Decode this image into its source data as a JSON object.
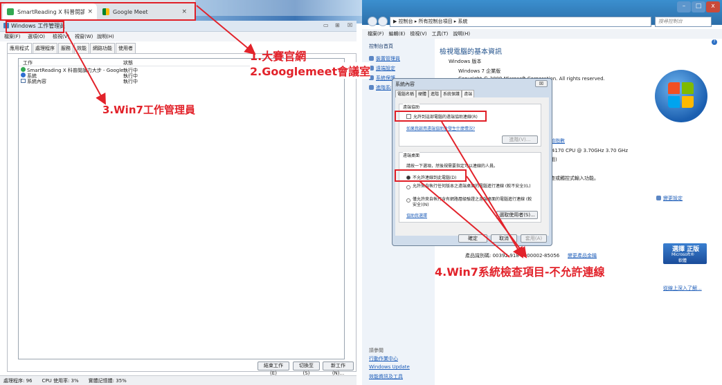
{
  "browser": {
    "tabs": [
      {
        "label": "SmartReading X 科普閱讀力大步",
        "close": "×"
      },
      {
        "label": "Google Meet",
        "close": "×"
      }
    ]
  },
  "task_manager": {
    "title": "Windows 工作管理員",
    "window_controls": [
      "▭",
      "⊞",
      "☒"
    ],
    "menu": [
      "檔案(F)",
      "選項(O)",
      "檢視(V)",
      "視窗(W)",
      "說明(H)"
    ],
    "tabs": [
      "應用程式",
      "處理程序",
      "服務",
      "效能",
      "網路功能",
      "使用者"
    ],
    "columns": {
      "task": "工作",
      "status": "狀態"
    },
    "rows": [
      {
        "task": "SmartReading X 科普閱讀力大步 - Google Chro...",
        "status": "執行中",
        "color": "#33a852"
      },
      {
        "task": "系統",
        "status": "執行中",
        "color": "#2f6fd1"
      },
      {
        "task": "系統內容",
        "status": "執行中",
        "color": "#4a6fa0"
      }
    ],
    "buttons": {
      "end": "結束工作(E)",
      "switch": "切換至(S)",
      "new": "新工作(N)..."
    },
    "status_bar": [
      "處理程序: 96",
      "CPU 使用率: 3%",
      "實體記憶體: 35%"
    ]
  },
  "control_panel": {
    "caption": [
      "–",
      "□",
      "x"
    ],
    "breadcrumb": "▶ 控制台 ▸ 所有控制台項目 ▸ 系統",
    "search_placeholder": "搜尋控制台",
    "menu": [
      "檔案(F)",
      "編輯(E)",
      "檢視(V)",
      "工具(T)",
      "說明(H)"
    ],
    "sidebar": {
      "home": "控制台首頁",
      "links": [
        "裝置管理員",
        "遠端設定",
        "系統保護",
        "進階系統設定"
      ],
      "see_also": "請參閱",
      "bottom_links": [
        "行動作業中心",
        "Windows Update",
        "效能資訊及工具"
      ]
    },
    "main": {
      "heading": "檢視電腦的基本資訊",
      "edition_label": "Windows 版本",
      "edition": "Windows 7 企業版",
      "copyright": "Copyright © 2009 Microsoft Corporation. All rights reserved.",
      "rating": "體驗指數",
      "cpu": "i3-4170 CPU @ 3.70GHz   3.70 GHz",
      "ram": "可用)",
      "pen": "筆查或觸控式輸入功能。",
      "change_settings": "變更設定",
      "product_id": "產品識別碼: 00392-918-5000002-85056",
      "change_key": "變更產品金鑰",
      "genuine_line1": "選擇 正版",
      "genuine_brand": "Microsoft®",
      "genuine_line2": "軟體",
      "learn_more": "從線上深入了解..."
    }
  },
  "dialog": {
    "title": "系統內容",
    "close": "☒",
    "tabs": [
      "電腦名稱",
      "硬體",
      "進階",
      "系統保護",
      "遠端"
    ],
    "assist_group": "遠端協助",
    "assist_checkbox": "允許到這部電腦的遠端協助連線(R)",
    "assist_link": "如果我啟用遠端協助會發生什麼情況?",
    "advanced_btn": "進階(V)...",
    "desktop_group": "遠端桌面",
    "desktop_hint": "請按一下選項，然後視需要指定可以連線的人員。",
    "radio_none": "不允許連線到此電腦(D)",
    "radio_any": "允許來自執行任何版本之遠端桌面的電腦進行連線 (較不安全)(L)",
    "radio_nla": "僅允許來自執行含有網路層級驗證之遠端桌面的電腦進行連線 (較安全)(N)",
    "help_link": "協助我選擇",
    "select_users": "選取使用者(S)...",
    "ok": "確定",
    "cancel": "取消",
    "apply": "套用(A)"
  },
  "annotations": {
    "a1": "1.大賽官網",
    "a2": "2.Googlemeet會議室",
    "a3": "3.Win7工作管理員",
    "a4": "4.Win7系統檢查項目-不允許連線"
  },
  "colors": {
    "annotation_red": "#e2222a",
    "cp_blue": "#2c6ea8"
  },
  "icons": [
    "chrome-icon",
    "google-meet-icon",
    "shield-icon",
    "windows-logo-icon",
    "help-icon",
    "search-icon",
    "back-icon",
    "forward-icon"
  ]
}
